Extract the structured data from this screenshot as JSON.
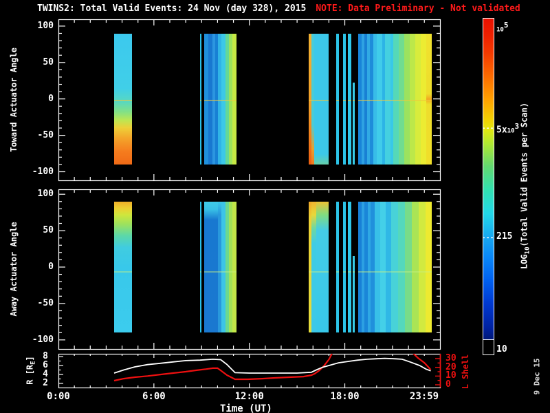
{
  "title": {
    "main": "TWINS2: Total Valid Events: 24 Nov (day 328), 2015",
    "note": "NOTE: Data Preliminary - Not validated"
  },
  "date_stamp": "9 Dec 15",
  "colors": {
    "background": "#000000",
    "frame": "#ffffff",
    "note_red": "#ff1a1a",
    "l_shell_red": "#ee1010",
    "r_line_white": "#ffffff",
    "date_stamp_gray": "#d8d8d8",
    "toward_highlight": "rgba(240,200,60,0.55)",
    "away_highlight": "rgba(200,240,130,0.45)"
  },
  "panels": {
    "toward": {
      "ylabel": "Toward Actuator Angle",
      "yticks": [
        100,
        50,
        0,
        -50,
        -100
      ]
    },
    "away": {
      "ylabel": "Away Actuator Angle",
      "yticks": [
        100,
        50,
        0,
        -50,
        -100
      ]
    },
    "orbit": {
      "ylabel_parts": {
        "pre": "R [R",
        "sub": "E",
        "post": "]"
      },
      "left_ticks": [
        8,
        6,
        4,
        2
      ],
      "right_label": "L Shell",
      "right_ticks": [
        30,
        20,
        10,
        0
      ]
    }
  },
  "xaxis": {
    "label": "Time (UT)",
    "ticks": [
      {
        "label": "0:00",
        "hour": 0
      },
      {
        "label": "6:00",
        "hour": 6
      },
      {
        "label": "12:00",
        "hour": 12
      },
      {
        "label": "18:00",
        "hour": 18
      },
      {
        "label": "23:59",
        "hour": 23.983
      }
    ]
  },
  "colorbar": {
    "label_parts": {
      "pre": "LOG",
      "sub": "10",
      "post": "(Total Valid Events per Scan)"
    },
    "ticks": [
      {
        "base": "10",
        "sup": "5",
        "frac": 0.012
      },
      {
        "pre": "5x",
        "base": "10",
        "sup": "3",
        "frac": 0.327,
        "dash": true
      },
      {
        "text": "215",
        "frac": 0.652,
        "dash": true
      },
      {
        "text": "10",
        "frac": 0.985
      }
    ],
    "stops": [
      [
        0.0,
        "#e81000"
      ],
      [
        0.05,
        "#ee2000"
      ],
      [
        0.1,
        "#f43800"
      ],
      [
        0.17,
        "#fc6a00"
      ],
      [
        0.24,
        "#ffa000"
      ],
      [
        0.3,
        "#f2d002"
      ],
      [
        0.33,
        "#e2e810"
      ],
      [
        0.37,
        "#b2e830"
      ],
      [
        0.44,
        "#62d870"
      ],
      [
        0.51,
        "#32e0b0"
      ],
      [
        0.58,
        "#22d8e8"
      ],
      [
        0.65,
        "#18a8f0"
      ],
      [
        0.71,
        "#0a88f8"
      ],
      [
        0.78,
        "#0060f0"
      ],
      [
        0.85,
        "#0038d0"
      ],
      [
        0.92,
        "#0022a2"
      ],
      [
        0.955,
        "#001878"
      ],
      [
        1.0,
        "#001060"
      ]
    ]
  },
  "chart_data": {
    "type": "heatmap",
    "x_range_hours": [
      0,
      23.983
    ],
    "angle_axis_range": [
      -100,
      100
    ],
    "band_angle_span": [
      90,
      -90
    ],
    "r_axis_range": [
      2,
      8
    ],
    "l_axis_range": [
      0,
      30
    ],
    "toward_highlight_angle": -1,
    "away_highlight_angle": -6,
    "toward_strips": [
      {
        "t": [
          3.5,
          4.62
        ],
        "g": [
          [
            0,
            "#3cc9ee"
          ],
          [
            0.42,
            "#40cfe8"
          ],
          [
            0.52,
            "#58d8c0"
          ],
          [
            0.6,
            "#84e184"
          ],
          [
            0.66,
            "#bce653"
          ],
          [
            0.72,
            "#eecf38"
          ],
          [
            0.8,
            "#f4a42a"
          ],
          [
            0.9,
            "#f57c1e"
          ],
          [
            1,
            "#f06a16"
          ]
        ]
      },
      {
        "t": [
          8.9,
          8.99
        ],
        "c": "#2ac0e8"
      },
      {
        "t": [
          9.16,
          9.42
        ],
        "c": "#2090dc"
      },
      {
        "t": [
          9.42,
          9.68
        ],
        "c": "#1878d0"
      },
      {
        "t": [
          9.68,
          9.85
        ],
        "c": "#2c96e0"
      },
      {
        "t": [
          9.85,
          10.03
        ],
        "c": "#1880d4"
      },
      {
        "t": [
          10.03,
          10.24
        ],
        "c": "#30b4e6"
      },
      {
        "t": [
          10.24,
          10.5
        ],
        "c": "#3cc8e8"
      },
      {
        "t": [
          10.5,
          10.72
        ],
        "c": "#64d898"
      },
      {
        "t": [
          10.72,
          10.93
        ],
        "c": "#9ce25c"
      },
      {
        "t": [
          10.93,
          11.19
        ],
        "c": "#c6e844"
      },
      {
        "t": [
          15.73,
          15.9
        ],
        "g": [
          [
            0,
            "#f2b132"
          ],
          [
            0.55,
            "#f29e28"
          ],
          [
            0.78,
            "#f2801c"
          ],
          [
            1,
            "#ee6012"
          ]
        ]
      },
      {
        "t": [
          15.9,
          16.08
        ],
        "g": [
          [
            0,
            "#48ccd8"
          ],
          [
            0.7,
            "#4accd6"
          ],
          [
            0.88,
            "#e8a030"
          ],
          [
            1,
            "#f07820"
          ]
        ]
      },
      {
        "t": [
          16.08,
          16.98
        ],
        "g": [
          [
            0,
            "#3cc8ea"
          ],
          [
            0.92,
            "#3cc8ea"
          ],
          [
            1,
            "#66d0aa"
          ]
        ]
      },
      {
        "t": [
          17.46,
          17.63
        ],
        "c": "#2cc4e8"
      },
      {
        "t": [
          17.89,
          18.06
        ],
        "c": "#2cc4e8"
      },
      {
        "t": [
          18.19,
          18.41
        ],
        "c": "#30c8ea"
      },
      {
        "t": [
          18.5,
          18.63
        ],
        "c": "#38cce8",
        "a0": 22
      },
      {
        "t": [
          18.84,
          19.06
        ],
        "c": "#1884d8"
      },
      {
        "t": [
          19.06,
          19.23
        ],
        "c": "#2ea2e2"
      },
      {
        "t": [
          19.23,
          19.4
        ],
        "c": "#1880d4"
      },
      {
        "t": [
          19.4,
          19.58
        ],
        "c": "#30aae4"
      },
      {
        "t": [
          19.58,
          19.79
        ],
        "c": "#1e8cda"
      },
      {
        "t": [
          19.79,
          20.01
        ],
        "c": "#38bce8"
      },
      {
        "t": [
          20.01,
          20.36
        ],
        "c": "#40ccea"
      },
      {
        "t": [
          20.36,
          20.53
        ],
        "c": "#2cb4e6"
      },
      {
        "t": [
          20.53,
          20.87
        ],
        "c": "#44d0e0"
      },
      {
        "t": [
          20.87,
          21.05
        ],
        "c": "#38c8e8"
      },
      {
        "t": [
          21.05,
          21.39
        ],
        "c": "#55d8b8"
      },
      {
        "t": [
          21.39,
          21.74
        ],
        "c": "#70dc90"
      },
      {
        "t": [
          21.74,
          22.08
        ],
        "c": "#9ce25e"
      },
      {
        "t": [
          22.08,
          22.43
        ],
        "c": "#bce84a"
      },
      {
        "t": [
          22.43,
          22.77
        ],
        "c": "#d8ec3c"
      },
      {
        "t": [
          22.77,
          23.12
        ],
        "c": "#ecec32"
      },
      {
        "t": [
          23.12,
          23.47
        ],
        "g": [
          [
            0,
            "#f0e22e"
          ],
          [
            0.46,
            "#eedd2c"
          ],
          [
            0.5,
            "#f2a622"
          ],
          [
            0.54,
            "#eedd2c"
          ],
          [
            1,
            "#f0de2a"
          ]
        ]
      }
    ],
    "away_strips": [
      {
        "t": [
          3.5,
          4.62
        ],
        "g": [
          [
            0,
            "#f0b028"
          ],
          [
            0.05,
            "#eecf32"
          ],
          [
            0.1,
            "#cfe63c"
          ],
          [
            0.17,
            "#9ee25c"
          ],
          [
            0.26,
            "#5cd8a8"
          ],
          [
            0.35,
            "#40cce0"
          ],
          [
            0.5,
            "#38c8ea"
          ],
          [
            1,
            "#3cccee"
          ]
        ]
      },
      {
        "t": [
          8.9,
          8.99
        ],
        "c": "#2ac0e8"
      },
      {
        "t": [
          9.16,
          10.03
        ],
        "g": [
          [
            0,
            "#40cce8"
          ],
          [
            0.06,
            "#38c0e6"
          ],
          [
            0.14,
            "#1878d0"
          ],
          [
            1,
            "#1a78d0"
          ]
        ]
      },
      {
        "t": [
          10.03,
          10.24
        ],
        "g": [
          [
            0,
            "#3cc8e8"
          ],
          [
            0.1,
            "#2898dc"
          ],
          [
            1,
            "#2898dc"
          ]
        ]
      },
      {
        "t": [
          10.24,
          10.5
        ],
        "c": "#3cc4e8"
      },
      {
        "t": [
          10.5,
          10.72
        ],
        "c": "#6cd890"
      },
      {
        "t": [
          10.72,
          10.93
        ],
        "c": "#a2e258"
      },
      {
        "t": [
          10.93,
          11.19
        ],
        "c": "#c2e648"
      },
      {
        "t": [
          15.73,
          15.9
        ],
        "g": [
          [
            0,
            "#f0a828"
          ],
          [
            0.12,
            "#ecd034"
          ],
          [
            1,
            "#e4dc3c"
          ]
        ]
      },
      {
        "t": [
          15.9,
          16.2
        ],
        "g": [
          [
            0,
            "#f0b430"
          ],
          [
            0.1,
            "#e8d83a"
          ],
          [
            0.2,
            "#70d8a0"
          ],
          [
            0.32,
            "#40cce4"
          ],
          [
            1,
            "#3cc8e8"
          ]
        ]
      },
      {
        "t": [
          16.2,
          16.98
        ],
        "g": [
          [
            0,
            "#ecc235"
          ],
          [
            0.1,
            "#80dc80"
          ],
          [
            0.22,
            "#44cce6"
          ],
          [
            1,
            "#38c8ea"
          ]
        ]
      },
      {
        "t": [
          17.46,
          17.63
        ],
        "c": "#2cc4e8"
      },
      {
        "t": [
          17.89,
          18.06
        ],
        "c": "#2cc4e8"
      },
      {
        "t": [
          18.19,
          18.41
        ],
        "c": "#30c8ea"
      },
      {
        "t": [
          18.5,
          18.63
        ],
        "c": "#38cce8",
        "a0": 15
      },
      {
        "t": [
          18.84,
          19.06
        ],
        "c": "#1880d6"
      },
      {
        "t": [
          19.06,
          19.23
        ],
        "c": "#2ca0e2"
      },
      {
        "t": [
          19.23,
          19.44
        ],
        "c": "#1a86d8"
      },
      {
        "t": [
          19.44,
          19.62
        ],
        "c": "#2ea8e4"
      },
      {
        "t": [
          19.62,
          19.88
        ],
        "c": "#2090dc"
      },
      {
        "t": [
          19.88,
          20.23
        ],
        "c": "#38c0e8"
      },
      {
        "t": [
          20.23,
          20.57
        ],
        "c": "#44d0e8"
      },
      {
        "t": [
          20.57,
          20.92
        ],
        "c": "#30b8e6"
      },
      {
        "t": [
          20.92,
          21.35
        ],
        "c": "#48d2d8"
      },
      {
        "t": [
          21.35,
          21.78
        ],
        "c": "#54d8bc"
      },
      {
        "t": [
          21.78,
          22.21
        ],
        "c": "#78dc88"
      },
      {
        "t": [
          22.21,
          22.64
        ],
        "c": "#aae455"
      },
      {
        "t": [
          22.64,
          23.07
        ],
        "c": "#d2ea40"
      },
      {
        "t": [
          23.07,
          23.47
        ],
        "c": "#eeea30"
      }
    ],
    "r_line_points": [
      [
        3.5,
        4.3
      ],
      [
        4.1,
        5.0
      ],
      [
        4.8,
        5.7
      ],
      [
        5.6,
        6.2
      ],
      [
        6.4,
        6.5
      ],
      [
        7.2,
        6.8
      ],
      [
        8.0,
        7.1
      ],
      [
        8.9,
        7.2
      ],
      [
        9.7,
        7.4
      ],
      [
        10.2,
        7.3
      ],
      [
        10.6,
        6.2
      ],
      [
        11.1,
        4.4
      ],
      [
        12,
        4.3
      ],
      [
        13,
        4.3
      ],
      [
        14,
        4.3
      ],
      [
        15,
        4.3
      ],
      [
        15.9,
        4.5
      ],
      [
        16.2,
        5.0
      ],
      [
        16.6,
        5.6
      ],
      [
        17.1,
        6.1
      ],
      [
        17.6,
        6.6
      ],
      [
        18.2,
        6.9
      ],
      [
        18.8,
        7.2
      ],
      [
        19.4,
        7.4
      ],
      [
        19.9,
        7.5
      ],
      [
        20.5,
        7.6
      ],
      [
        21.2,
        7.5
      ],
      [
        21.6,
        7.4
      ],
      [
        22.1,
        6.8
      ],
      [
        22.7,
        6.0
      ],
      [
        23.1,
        5.2
      ],
      [
        23.4,
        4.8
      ]
    ],
    "l_line_segments": [
      [
        [
          3.5,
          4.7
        ],
        [
          4.1,
          7.0
        ],
        [
          4.8,
          8.7
        ],
        [
          5.6,
          10.0
        ],
        [
          6.4,
          11.8
        ],
        [
          7.2,
          13.4
        ],
        [
          8.0,
          15.0
        ],
        [
          8.6,
          16.5
        ],
        [
          9.3,
          18.0
        ],
        [
          9.7,
          19.0
        ],
        [
          10.0,
          19.0
        ],
        [
          10.2,
          16.5
        ],
        [
          10.6,
          11.0
        ],
        [
          11.1,
          6.3
        ],
        [
          11.9,
          6.3
        ],
        [
          12.8,
          7.0
        ],
        [
          13.6,
          7.9
        ],
        [
          14.5,
          8.7
        ],
        [
          15.4,
          9.4
        ],
        [
          15.9,
          11.0
        ],
        [
          16.1,
          12.6
        ],
        [
          16.4,
          16.5
        ],
        [
          16.7,
          22.0
        ],
        [
          17.0,
          29.0
        ],
        [
          17.2,
          36.0
        ]
      ],
      [
        [
          22.3,
          36.0
        ],
        [
          22.6,
          30.7
        ],
        [
          23.0,
          25.2
        ],
        [
          23.2,
          21.3
        ],
        [
          23.4,
          17.3
        ]
      ]
    ]
  }
}
